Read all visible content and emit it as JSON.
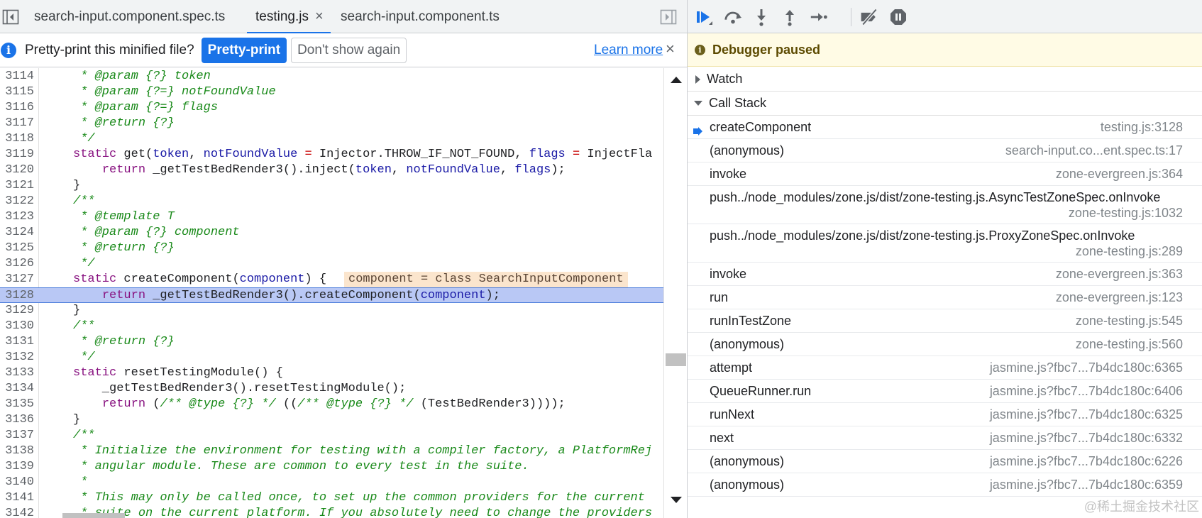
{
  "editor": {
    "tabs": [
      {
        "label": "search-input.component.spec.ts"
      },
      {
        "label": "testing.js",
        "close": "×"
      },
      {
        "label": "search-input.component.ts"
      }
    ],
    "infobar": {
      "message": "Pretty-print this minified file?",
      "primary_button": "Pretty-print",
      "secondary_button": "Don't show again",
      "link": "Learn more",
      "close": "×"
    },
    "inline_value": "component = class SearchInputComponent",
    "lines": [
      {
        "n": "3114",
        "text": " * @param {?} token"
      },
      {
        "n": "3115",
        "text": " * @param {?=} notFoundValue"
      },
      {
        "n": "3116",
        "text": " * @param {?=} flags"
      },
      {
        "n": "3117",
        "text": " * @return {?}"
      },
      {
        "n": "3118",
        "text": " */"
      },
      {
        "n": "3119",
        "text": "static get(token, notFoundValue = Injector.THROW_IF_NOT_FOUND, flags = InjectFla"
      },
      {
        "n": "3120",
        "text": "    return _getTestBedRender3().inject(token, notFoundValue, flags);"
      },
      {
        "n": "3121",
        "text": "}"
      },
      {
        "n": "3122",
        "text": "/**"
      },
      {
        "n": "3123",
        "text": " * @template T"
      },
      {
        "n": "3124",
        "text": " * @param {?} component"
      },
      {
        "n": "3125",
        "text": " * @return {?}"
      },
      {
        "n": "3126",
        "text": " */"
      },
      {
        "n": "3127",
        "text": "static createComponent(component) {"
      },
      {
        "n": "3128",
        "text": "    return _getTestBedRender3().createComponent(component);"
      },
      {
        "n": "3129",
        "text": "}"
      },
      {
        "n": "3130",
        "text": "/**"
      },
      {
        "n": "3131",
        "text": " * @return {?}"
      },
      {
        "n": "3132",
        "text": " */"
      },
      {
        "n": "3133",
        "text": "static resetTestingModule() {"
      },
      {
        "n": "3134",
        "text": "    _getTestBedRender3().resetTestingModule();"
      },
      {
        "n": "3135",
        "text": "    return (/** @type {?} */ ((/** @type {?} */ (TestBedRender3))));"
      },
      {
        "n": "3136",
        "text": "}"
      },
      {
        "n": "3137",
        "text": "/**"
      },
      {
        "n": "3138",
        "text": " * Initialize the environment for testing with a compiler factory, a PlatformRej"
      },
      {
        "n": "3139",
        "text": " * angular module. These are common to every test in the suite."
      },
      {
        "n": "3140",
        "text": " *"
      },
      {
        "n": "3141",
        "text": " * This may only be called once, to set up the common providers for the current"
      },
      {
        "n": "3142",
        "text": " * suite on the current platform. If you absolutely need to change the providers"
      }
    ],
    "highlighted_line": "3128"
  },
  "debugger": {
    "toolbar_icons": [
      "resume-icon",
      "step-over-icon",
      "step-into-icon",
      "step-out-icon",
      "step-icon",
      "deactivate-breakpoints-icon",
      "pause-on-exceptions-icon"
    ],
    "status": "Debugger paused",
    "sections": {
      "watch": "Watch",
      "call_stack": "Call Stack"
    },
    "call_stack": [
      {
        "name": "createComponent",
        "loc": "testing.js:3128",
        "current": true
      },
      {
        "name": "(anonymous)",
        "loc": "search-input.co...ent.spec.ts:17"
      },
      {
        "name": "invoke",
        "loc": "zone-evergreen.js:364"
      },
      {
        "name": "push../node_modules/zone.js/dist/zone-testing.js.AsyncTestZoneSpec.onInvoke",
        "loc": "zone-testing.js:1032",
        "wrap": true
      },
      {
        "name": "push../node_modules/zone.js/dist/zone-testing.js.ProxyZoneSpec.onInvoke",
        "loc": "zone-testing.js:289",
        "wrap": true
      },
      {
        "name": "invoke",
        "loc": "zone-evergreen.js:363"
      },
      {
        "name": "run",
        "loc": "zone-evergreen.js:123"
      },
      {
        "name": "runInTestZone",
        "loc": "zone-testing.js:545"
      },
      {
        "name": "(anonymous)",
        "loc": "zone-testing.js:560"
      },
      {
        "name": "attempt",
        "loc": "jasmine.js?fbc7...7b4dc180c:6365"
      },
      {
        "name": "QueueRunner.run",
        "loc": "jasmine.js?fbc7...7b4dc180c:6406"
      },
      {
        "name": "runNext",
        "loc": "jasmine.js?fbc7...7b4dc180c:6325"
      },
      {
        "name": "next",
        "loc": "jasmine.js?fbc7...7b4dc180c:6332"
      },
      {
        "name": "(anonymous)",
        "loc": "jasmine.js?fbc7...7b4dc180c:6226"
      },
      {
        "name": "(anonymous)",
        "loc": "jasmine.js?fbc7...7b4dc180c:6359"
      }
    ]
  },
  "watermark": "@稀土掘金技术社区",
  "colors": {
    "accent": "#1a73e8",
    "paused_bg": "#fffbe5",
    "highlight": "#b9c8f5"
  }
}
